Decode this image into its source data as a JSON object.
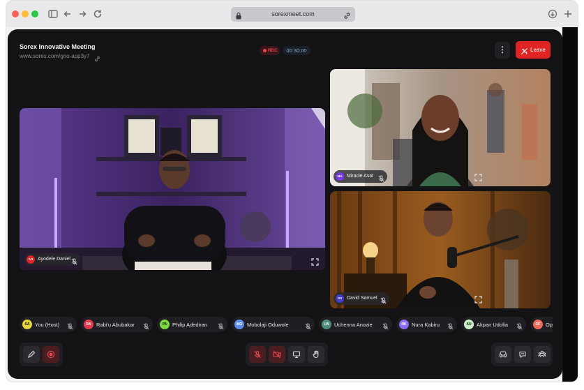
{
  "browser": {
    "url": "sorexmeet.com",
    "icons": [
      "sidebar-icon",
      "back-icon",
      "forward-icon",
      "reload-icon",
      "lock-icon",
      "link-icon",
      "download-icon",
      "new-tab-icon"
    ]
  },
  "meeting": {
    "title": "Sorex Innovative Meeting",
    "link": "www.sorex.com/goo-app3y7",
    "rec_label": "REC",
    "timer": "00:30:00",
    "leave_label": "Leave",
    "more_label": "⋮"
  },
  "tiles": [
    {
      "name": "Ayodele Daniel",
      "initials": "AD",
      "avatar_color": "#e02424"
    },
    {
      "name": "Miracle Asat",
      "initials": "MA",
      "avatar_color": "#7c3aed"
    },
    {
      "name": "David Samuel",
      "initials": "DS",
      "avatar_color": "#4338ca"
    }
  ],
  "participants": [
    {
      "name": "You (Host)",
      "initials": "SA",
      "color": "#e4d53a"
    },
    {
      "name": "Rabi'u Abubakar",
      "initials": "RA",
      "color": "#e23b4e"
    },
    {
      "name": "Philip Adediran",
      "initials": "PA",
      "color": "#7ad83a"
    },
    {
      "name": "Mobolaji Oduwole",
      "initials": "MO",
      "color": "#5b8def"
    },
    {
      "name": "Uchenna Anozie",
      "initials": "UA",
      "color": "#4f8d7d"
    },
    {
      "name": "Nura Kabiru",
      "initials": "NK",
      "color": "#8b6cf0"
    },
    {
      "name": "Akpan Udofia",
      "initials": "AU",
      "color": "#c9f0c6"
    },
    {
      "name": "Opeyemi",
      "initials": "OF",
      "color": "#f06a5a"
    }
  ],
  "colors": {
    "background": "#131316",
    "accent_red": "#e02424",
    "panel": "#1f1f23"
  }
}
